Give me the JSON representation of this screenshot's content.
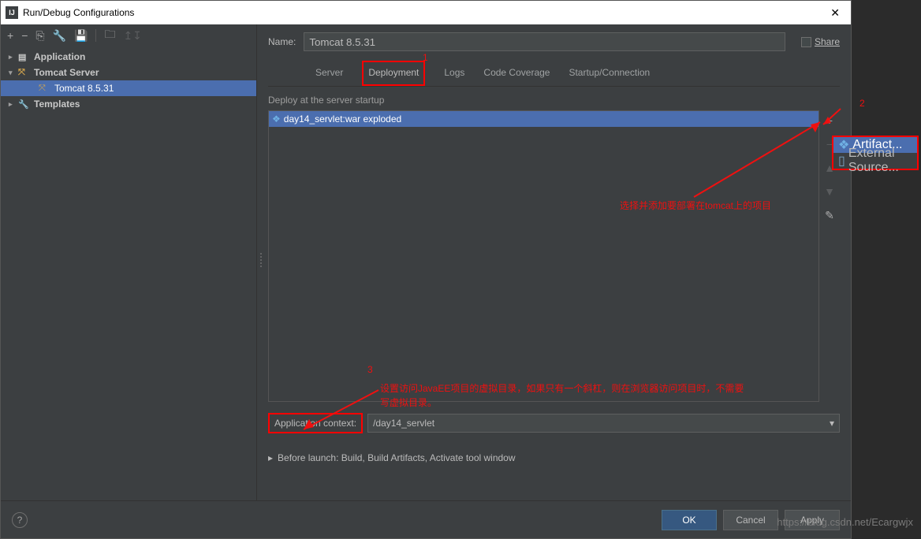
{
  "titlebar": {
    "title": "Run/Debug Configurations",
    "close": "✕",
    "logo": "IJ"
  },
  "toolbar": {
    "add": "+",
    "remove": "−",
    "copy": "⎘",
    "edit": "🔧",
    "save": "💾",
    "folder": "🗀",
    "up": "↥↧"
  },
  "tree": {
    "application": "Application",
    "tomcat_server": "Tomcat Server",
    "tomcat_item": "Tomcat 8.5.31",
    "templates": "Templates"
  },
  "name": {
    "label": "Name:",
    "value": "Tomcat 8.5.31"
  },
  "share": {
    "label": "Share"
  },
  "tabs": {
    "server": "Server",
    "deployment": "Deployment",
    "logs": "Logs",
    "coverage": "Code Coverage",
    "startup": "Startup/Connection"
  },
  "deploy": {
    "section": "Deploy at the server startup",
    "item": "day14_servlet:war exploded"
  },
  "sidebtn": {
    "add": "+",
    "remove": "−",
    "up": "▲",
    "down": "▼",
    "edit": "✎"
  },
  "context": {
    "label": "Application context:",
    "value": "/day14_servlet",
    "caret": "▾"
  },
  "before": {
    "arrow": "▸",
    "text": "Before launch: Build, Build Artifacts, Activate tool window"
  },
  "footer": {
    "help": "?",
    "ok": "OK",
    "cancel": "Cancel",
    "apply": "Apply"
  },
  "popup": {
    "artifact": "Artifact...",
    "external": "External Source..."
  },
  "ann": {
    "n1": "1",
    "n2": "2",
    "n3": "3",
    "tip1": "选择并添加要部署在tomcat上的项目",
    "tip2a": "设置访问JavaEE项目的虚拟目录，如果只有一个斜杠，则在浏览器访问项目时，不需要",
    "tip2b": "写虚拟目录。"
  },
  "watermark": "https://blog.csdn.net/Ecargwjx"
}
